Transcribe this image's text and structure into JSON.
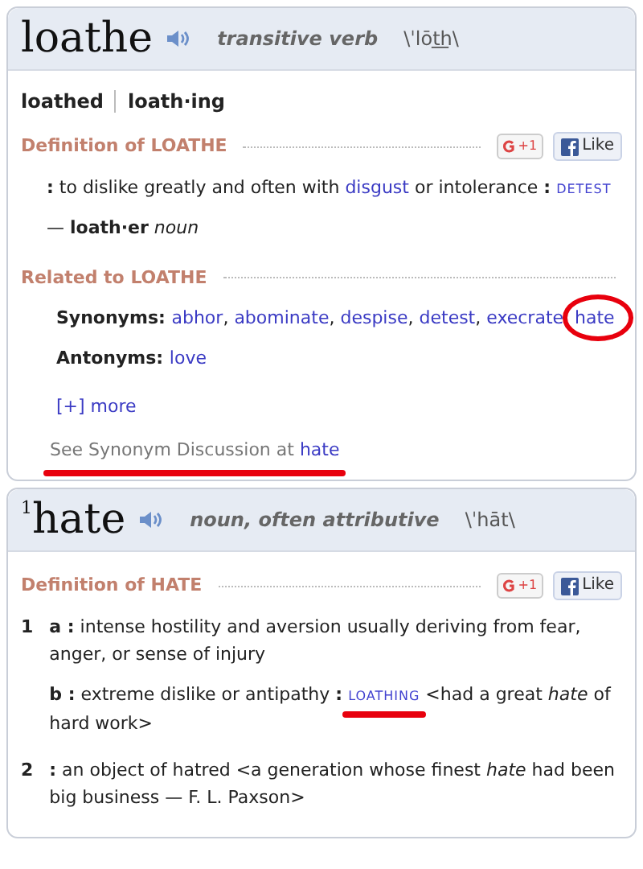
{
  "entries": [
    {
      "headword": "loathe",
      "pos": "transitive verb",
      "pron": "\\ˈlōt͟h\\",
      "inflections": [
        "loathed",
        "loath·ing"
      ],
      "sections": [
        {
          "kind": "definition",
          "title": "Definition of LOATHE",
          "plus": "+1",
          "like": "Like",
          "senses": [
            {
              "subs": [
                {
                  "segments": [
                    {
                      "kind": "text",
                      "s": "**:** to dislike greatly and often with "
                    },
                    {
                      "kind": "link",
                      "s": "disgust"
                    },
                    {
                      "kind": "text",
                      "s": " or intolerance **:** "
                    },
                    {
                      "kind": "sc",
                      "s": "DETEST"
                    }
                  ]
                }
              ]
            }
          ],
          "runon": "— **loath·er** *noun*"
        },
        {
          "kind": "related",
          "title": "Related to LOATHE",
          "rows": [
            {
              "label": "Synonyms:",
              "sep": ",",
              "words": [
                {
                  "s": "abhor",
                  "marked": false
                },
                {
                  "s": "abominate",
                  "marked": false
                },
                {
                  "s": "despise",
                  "marked": false
                },
                {
                  "s": "detest",
                  "marked": false
                },
                {
                  "s": "execrate",
                  "marked": false
                },
                {
                  "s": "hate",
                  "marked": true
                }
              ]
            },
            {
              "label": "Antonyms:",
              "words": [
                {
                  "s": "love",
                  "marked": false
                }
              ]
            }
          ],
          "more": "[+] more",
          "discussion": {
            "text": "See Synonym Discussion at",
            "link": "hate",
            "marked": true
          }
        }
      ]
    },
    {
      "homograph": "1",
      "headword": "hate",
      "pos": "noun, often attributive",
      "pron": "\\ˈhāt\\",
      "sections": [
        {
          "kind": "definition",
          "title": "Definition of HATE",
          "plus": "+1",
          "like": "Like",
          "senses": [
            {
              "number": "1",
              "subs": [
                {
                  "segments": [
                    {
                      "kind": "text",
                      "s": "**a :** intense hostility and aversion usually deriving from fear, anger, or sense of injury"
                    }
                  ]
                },
                {
                  "segments": [
                    {
                      "kind": "text",
                      "s": "**b :** extreme dislike or antipathy **:** "
                    },
                    {
                      "kind": "sc",
                      "s": "LOATHING",
                      "marked": true
                    },
                    {
                      "kind": "text",
                      "s": " <had a great *hate* of hard work>"
                    }
                  ]
                }
              ]
            },
            {
              "number": "2",
              "subs": [
                {
                  "segments": [
                    {
                      "kind": "text",
                      "s": "**:** an object of hatred <a generation whose finest *hate* had been big business — F. L. Paxson>"
                    }
                  ]
                }
              ]
            }
          ]
        }
      ]
    }
  ]
}
